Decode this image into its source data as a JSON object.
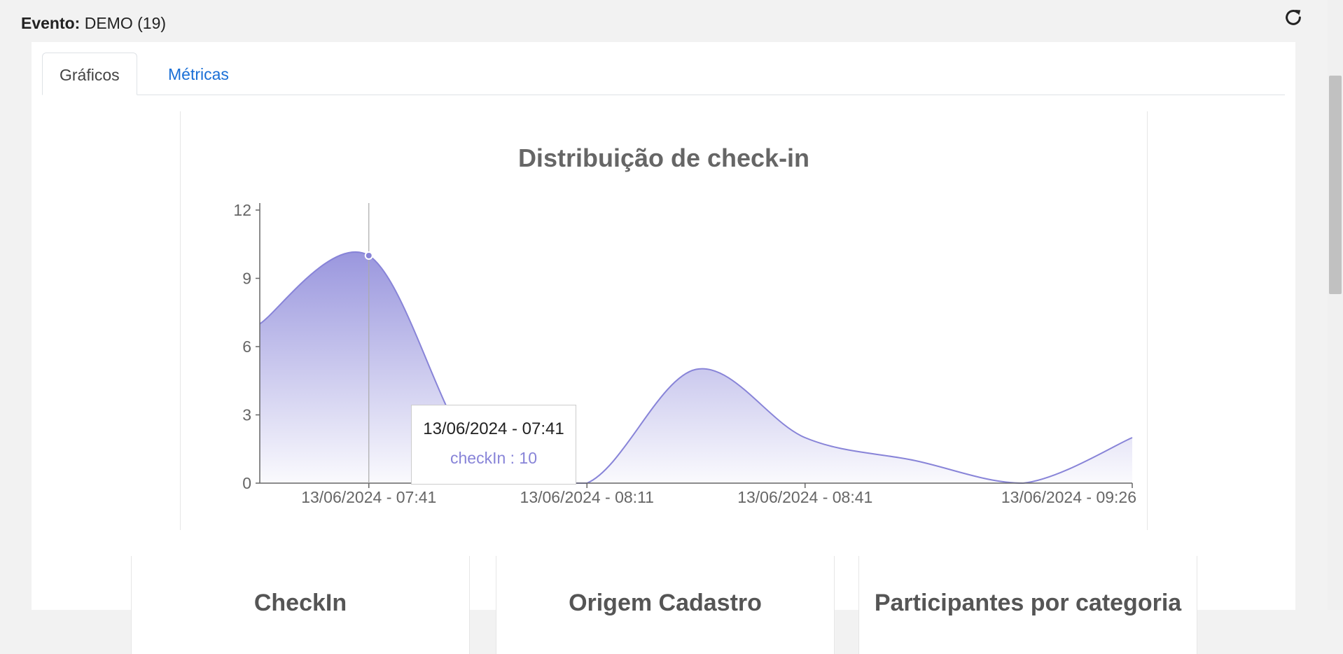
{
  "header": {
    "event_label": "Evento:",
    "event_value": "DEMO (19)",
    "refresh_icon": "refresh-icon"
  },
  "tabs": [
    {
      "label": "Gráficos",
      "active": true
    },
    {
      "label": "Métricas",
      "active": false
    }
  ],
  "chart_data": {
    "type": "area",
    "title": "Distribuição de check-in",
    "xlabel": "",
    "ylabel": "",
    "ylim": [
      0,
      12
    ],
    "yticks": [
      0,
      3,
      6,
      9,
      12
    ],
    "xtick_labels": [
      "13/06/2024 - 07:41",
      "13/06/2024 - 08:11",
      "13/06/2024 - 08:41",
      "13/06/2024 - 09:26"
    ],
    "series": [
      {
        "name": "checkIn",
        "points": [
          {
            "x": "13/06/2024 - 07:26",
            "y": 7
          },
          {
            "x": "13/06/2024 - 07:41",
            "y": 10
          },
          {
            "x": "13/06/2024 - 07:56",
            "y": 1
          },
          {
            "x": "13/06/2024 - 08:11",
            "y": 0
          },
          {
            "x": "13/06/2024 - 08:26",
            "y": 5
          },
          {
            "x": "13/06/2024 - 08:41",
            "y": 2
          },
          {
            "x": "13/06/2024 - 08:56",
            "y": 1
          },
          {
            "x": "13/06/2024 - 09:11",
            "y": 0
          },
          {
            "x": "13/06/2024 - 09:26",
            "y": 2
          }
        ]
      }
    ],
    "color": "#8884d8",
    "grid": false,
    "tooltip": {
      "label": "13/06/2024 - 07:41",
      "text": "checkIn : 10"
    }
  },
  "cards": [
    {
      "title": "CheckIn"
    },
    {
      "title": "Origem Cadastro"
    },
    {
      "title": "Participantes por categoria"
    }
  ]
}
